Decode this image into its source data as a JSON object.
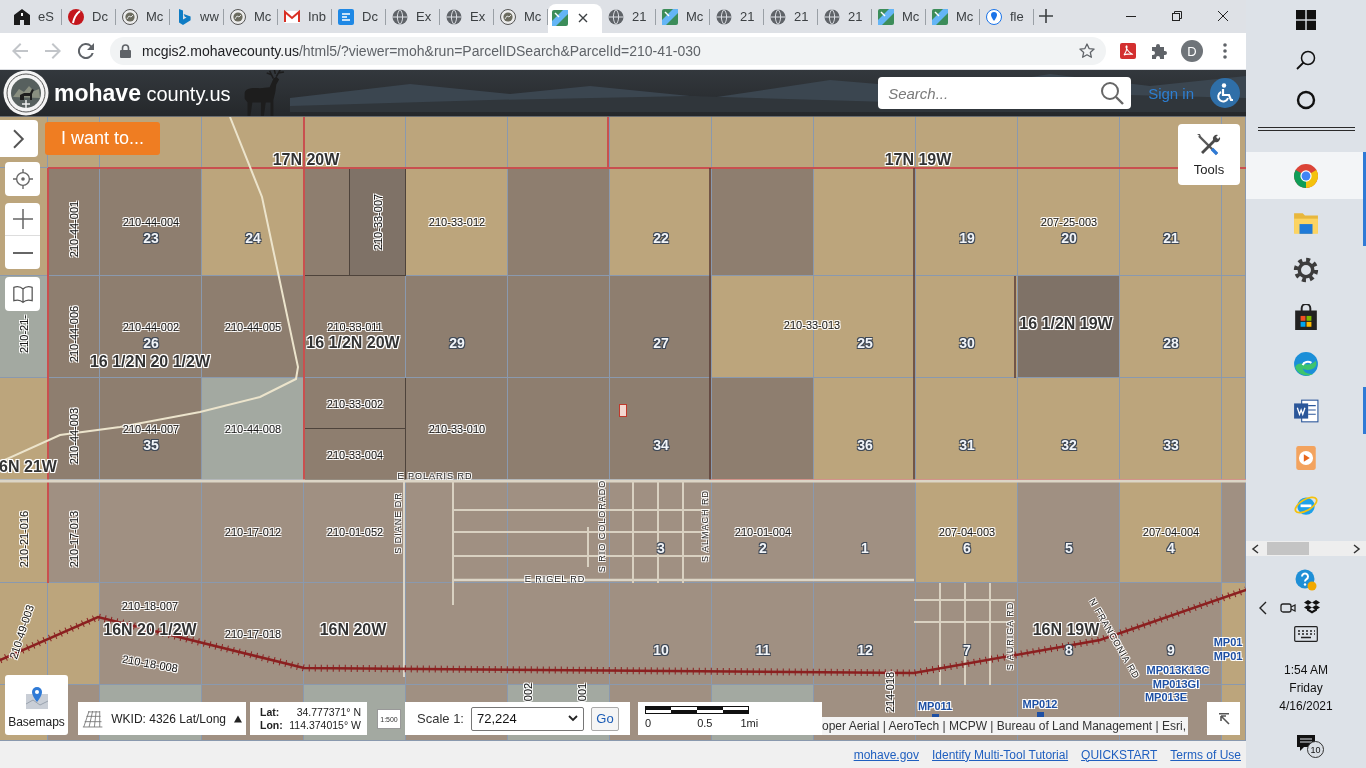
{
  "browser": {
    "tabs": [
      {
        "kind": "building",
        "title": "eS",
        "selected": false
      },
      {
        "kind": "swoosh",
        "title": "Dc",
        "selected": false
      },
      {
        "kind": "seal",
        "title": "Mc",
        "selected": false
      },
      {
        "kind": "ribbon",
        "title": "ww",
        "selected": false
      },
      {
        "kind": "seal",
        "title": "Mc",
        "selected": false
      },
      {
        "kind": "envelope",
        "title": "Inb",
        "selected": false
      },
      {
        "kind": "square",
        "title": "Dc",
        "selected": false
      },
      {
        "kind": "globe",
        "title": "Ex",
        "selected": false
      },
      {
        "kind": "globe",
        "title": "Ex",
        "selected": false
      },
      {
        "kind": "seal",
        "title": "Mc",
        "selected": false
      },
      {
        "kind": "map",
        "selected": true
      },
      {
        "kind": "globe",
        "title": "21",
        "selected": false
      },
      {
        "kind": "map",
        "title": "Mc",
        "selected": false
      },
      {
        "kind": "globe",
        "title": "21",
        "selected": false
      },
      {
        "kind": "globe",
        "title": "21",
        "selected": false
      },
      {
        "kind": "globe",
        "title": "21",
        "selected": false
      },
      {
        "kind": "map",
        "title": "Mc",
        "selected": false
      },
      {
        "kind": "map",
        "title": "Mc",
        "selected": false
      },
      {
        "kind": "pin",
        "title": "fle",
        "selected": false
      }
    ],
    "toolbar": {
      "back": {
        "disabled": true
      },
      "forward": {
        "disabled": true
      },
      "url_host": "mcgis2.mohavecounty.us",
      "url_path": "/html5/?viewer=moh&run=ParcelIDSearch&ParcelId=210-41-030",
      "profile_initial": "D"
    }
  },
  "header": {
    "brand_name": "mohave",
    "brand_suffix": "county.us",
    "search": {
      "placeholder": "Search..."
    },
    "sign_in": "Sign in"
  },
  "map": {
    "i_want_to": "I want to...",
    "tools_label": "Tools",
    "grid": [
      {
        "cells": [
          {
            "kind": "plain",
            "color": "#bca57c"
          },
          {
            "kind": "plain",
            "color": "#bca57c"
          },
          {
            "kind": "plain",
            "color": "#bca57c"
          },
          {
            "kind": "plain",
            "color": "#bca57c"
          },
          {
            "kind": "plain",
            "color": "#bca57c"
          },
          {
            "kind": "plain",
            "color": "#bca57c"
          },
          {
            "kind": "plain",
            "color": "#bca57c"
          },
          {
            "kind": "plain",
            "color": "#bca57c"
          },
          {
            "kind": "plain",
            "color": "#bca57c"
          },
          {
            "kind": "plain",
            "color": "#bca57c"
          },
          {
            "kind": "plain",
            "color": "#bca57c"
          },
          {
            "kind": "plain",
            "color": "#bca57c"
          },
          {
            "kind": "plain",
            "color": "#bca57c"
          },
          {
            "kind": "plain",
            "color": "#bca57c"
          }
        ]
      },
      {
        "cells": [
          {
            "kind": "covered"
          },
          {
            "kind": "vertical",
            "color": "#8e7e6f",
            "parcel": "210-44-001"
          },
          {
            "kind": "plain",
            "color": "#8e7e6f",
            "parcel": "210-44-004",
            "section": "23"
          },
          {
            "kind": "plain",
            "color": "#bca57c",
            "section": "24"
          },
          {
            "kind": "split-v",
            "parts": [
              {
                "color": "#8e7e6f"
              },
              {
                "color": "#7f7267",
                "parcel": "210-33-007"
              }
            ]
          },
          {
            "kind": "plain",
            "color": "#bca57c",
            "parcel": "210-33-012"
          },
          {
            "kind": "plain",
            "color": "#8e7e6f"
          },
          {
            "kind": "plain",
            "color": "#bca57c",
            "section": "22"
          },
          {
            "kind": "plain",
            "color": "#8e7e6f"
          },
          {
            "kind": "plain",
            "color": "#bca57c"
          },
          {
            "kind": "plain",
            "color": "#bca57c",
            "section": "19"
          },
          {
            "kind": "plain",
            "color": "#bca57c",
            "parcel": "207-25-003",
            "section": "20"
          },
          {
            "kind": "plain",
            "color": "#bca57c",
            "section": "21"
          },
          {
            "kind": "plain",
            "color": "#bca57c"
          }
        ]
      },
      {
        "cells": [
          {
            "kind": "vertical",
            "color": "#a3a9a1",
            "parcel": "210-21-"
          },
          {
            "kind": "vertical",
            "color": "#8e7e6f",
            "parcel": "210-44-006"
          },
          {
            "kind": "plain",
            "color": "#8e7e6f",
            "parcel": "210-44-002",
            "section": "26"
          },
          {
            "kind": "plain",
            "color": "#8e7e6f",
            "parcel": "210-44-005"
          },
          {
            "kind": "plain",
            "color": "#8e7e6f",
            "parcel": "210-33-011"
          },
          {
            "kind": "plain",
            "color": "#8e7e6f",
            "section": "29"
          },
          {
            "kind": "plain",
            "color": "#8e7e6f"
          },
          {
            "kind": "plain",
            "color": "#8e7e6f",
            "section": "27"
          },
          {
            "kind": "plain",
            "color": "#bca57c"
          },
          {
            "kind": "plain",
            "color": "#bca57c",
            "section": "25"
          },
          {
            "kind": "plain",
            "color": "#bca57c",
            "section": "30"
          },
          {
            "kind": "plain",
            "color": "#7f7267"
          },
          {
            "kind": "plain",
            "color": "#bca57c",
            "section": "28"
          },
          {
            "kind": "plain",
            "color": "#bca57c"
          }
        ]
      },
      {
        "cells": [
          {
            "kind": "plain",
            "color": "#bca57c"
          },
          {
            "kind": "vertical",
            "color": "#8e7e6f",
            "parcel": "210-44-003"
          },
          {
            "kind": "plain",
            "color": "#8e7e6f",
            "parcel": "210-44-007",
            "section": "35"
          },
          {
            "kind": "plain",
            "color": "#a3a9a1",
            "parcel": "210-44-008"
          },
          {
            "kind": "split-h",
            "parts": [
              {
                "color": "#8e7e6f",
                "parcel": "210-33-002"
              },
              {
                "color": "#8e7e6f",
                "parcel": "210-33-004"
              }
            ]
          },
          {
            "kind": "plain",
            "color": "#8e7e6f",
            "parcel": "210-33-010"
          },
          {
            "kind": "plain",
            "color": "#8e7e6f"
          },
          {
            "kind": "plain",
            "color": "#8e7e6f",
            "section": "34"
          },
          {
            "kind": "plain",
            "color": "#8e7e6f"
          },
          {
            "kind": "plain",
            "color": "#bca57c",
            "section": "36"
          },
          {
            "kind": "plain",
            "color": "#bca57c",
            "section": "31"
          },
          {
            "kind": "plain",
            "color": "#bca57c",
            "section": "32"
          },
          {
            "kind": "plain",
            "color": "#bca57c",
            "section": "33"
          },
          {
            "kind": "plain",
            "color": "#bca57c"
          }
        ]
      },
      {
        "cells": [
          {
            "kind": "vertical",
            "color": "#bca57c",
            "parcel": "210-21-016"
          },
          {
            "kind": "vertical",
            "color": "#a09082",
            "parcel": "210-17-013"
          },
          {
            "kind": "plain",
            "color": "#a09082"
          },
          {
            "kind": "plain",
            "color": "#a09082",
            "parcel": "210-17-012"
          },
          {
            "kind": "plain",
            "color": "#a09082",
            "parcel": "210-01-052"
          },
          {
            "kind": "plain",
            "color": "#a09082"
          },
          {
            "kind": "plain",
            "color": "#a09082"
          },
          {
            "kind": "plain",
            "color": "#a09082",
            "section": "3"
          },
          {
            "kind": "plain",
            "color": "#a09082",
            "parcel": "210-01-004",
            "section": "2"
          },
          {
            "kind": "plain",
            "color": "#a09082",
            "section": "1"
          },
          {
            "kind": "plain",
            "color": "#bca57c",
            "parcel": "207-04-003",
            "section": "6"
          },
          {
            "kind": "plain",
            "color": "#a09082",
            "section": "5"
          },
          {
            "kind": "plain",
            "color": "#bca57c",
            "parcel": "207-04-004",
            "section": "4"
          },
          {
            "kind": "plain",
            "color": "#a09082"
          }
        ]
      },
      {
        "cells": [
          {
            "kind": "plain",
            "color": "#bca57c"
          },
          {
            "kind": "plain",
            "color": "#bca57c"
          },
          {
            "kind": "plain",
            "color": "#a09082"
          },
          {
            "kind": "plain",
            "color": "#a09082",
            "parcel": "210-17-018"
          },
          {
            "kind": "plain",
            "color": "#a09082"
          },
          {
            "kind": "plain",
            "color": "#a09082"
          },
          {
            "kind": "plain",
            "color": "#a09082"
          },
          {
            "kind": "plain",
            "color": "#a09082",
            "section": "10"
          },
          {
            "kind": "plain",
            "color": "#a09082",
            "section": "11"
          },
          {
            "kind": "plain",
            "color": "#a09082",
            "section": "12"
          },
          {
            "kind": "plain",
            "color": "#a09082",
            "section": "7"
          },
          {
            "kind": "plain",
            "color": "#a09082",
            "section": "8"
          },
          {
            "kind": "plain",
            "color": "#a09082",
            "section": "9"
          },
          {
            "kind": "plain",
            "color": "#bca57c"
          }
        ]
      },
      {
        "cells": [
          {
            "kind": "plain",
            "color": "#bca57c"
          },
          {
            "kind": "plain",
            "color": "#a09082"
          },
          {
            "kind": "plain",
            "color": "#a3a9a1"
          },
          {
            "kind": "plain",
            "color": "#a09082"
          },
          {
            "kind": "plain",
            "color": "#a3a9a1"
          },
          {
            "kind": "plain",
            "color": "#a09082"
          },
          {
            "kind": "plain",
            "color": "#a3a9a1"
          },
          {
            "kind": "plain",
            "color": "#a09082"
          },
          {
            "kind": "plain",
            "color": "#a3a9a1"
          },
          {
            "kind": "plain",
            "color": "#a09082"
          },
          {
            "kind": "plain",
            "color": "#a09082"
          },
          {
            "kind": "plain",
            "color": "#a09082"
          },
          {
            "kind": "plain",
            "color": "#a09082"
          },
          {
            "kind": "plain",
            "color": "#bca57c"
          }
        ]
      }
    ],
    "labels": [
      {
        "kind": "township",
        "text": "17N 20W"
      },
      {
        "kind": "township",
        "text": "17N 19W"
      },
      {
        "kind": "township",
        "text": "16 1/2N 19W"
      },
      {
        "kind": "parcel",
        "text": "210-33-013"
      },
      {
        "kind": "township",
        "text": "16 1/2N 20W"
      },
      {
        "kind": "township",
        "text": "16 1/2N 20 1/2W"
      },
      {
        "kind": "township",
        "text": "6N 21W"
      },
      {
        "kind": "road",
        "text": "E POLARIS RD"
      },
      {
        "kind": "road",
        "text": "S DIANE DR"
      },
      {
        "kind": "road",
        "text": "S RIO COLORADO"
      },
      {
        "kind": "road",
        "text": "S ALMACH RD"
      },
      {
        "kind": "road",
        "text": "E RIGEL RD"
      },
      {
        "kind": "parcel",
        "text": "210-18-007"
      },
      {
        "kind": "road",
        "text": "S AURIGA RD"
      },
      {
        "kind": "township",
        "text": "16N 20 1/2W"
      },
      {
        "kind": "township",
        "text": "16N 20W"
      },
      {
        "kind": "township",
        "text": "16N 19W"
      },
      {
        "kind": "parcel",
        "text": "210-49-003"
      },
      {
        "kind": "road",
        "text": "N FRANCONIA RD"
      },
      {
        "kind": "milepost",
        "text": "MP01"
      },
      {
        "kind": "milepost",
        "text": "MP01"
      },
      {
        "kind": "parcel",
        "text": "210-18-008"
      },
      {
        "kind": "milepost",
        "text": "MP013K13C"
      },
      {
        "kind": "milepost",
        "text": "MP013GI"
      },
      {
        "kind": "milepost",
        "text": "MP013E"
      },
      {
        "kind": "parcel",
        "text": "002"
      },
      {
        "kind": "parcel",
        "text": "001"
      },
      {
        "kind": "parcel",
        "text": "214-018"
      },
      {
        "kind": "milepost",
        "text": "MP012"
      },
      {
        "kind": "milepost",
        "text": "MP011"
      }
    ]
  },
  "map_footer": {
    "basemaps_label": "Basemaps",
    "projection": "WKID: 4326 Lat/Long",
    "lat_label": "Lat:",
    "lat": "34.777371° N",
    "lon_label": "Lon:",
    "lon": "114.374015° W",
    "scale_icon_text": "1:500",
    "scale_label": "Scale 1:",
    "scale_value": "72,224",
    "go": "Go",
    "scale_bar_ticks": [
      "0",
      "0.5",
      "1mi"
    ],
    "attribution": "oper Aerial | AeroTech | MCPW | Bureau of Land Management | Esri,"
  },
  "footer_links": [
    "mohave.gov",
    "Identify Multi-Tool Tutorial",
    "QUICKSTART",
    "Terms of Use"
  ],
  "taskbar": {
    "apps": [
      {
        "kind": "ring",
        "running": true,
        "selected": true
      },
      {
        "kind": "folder",
        "running": true,
        "selected": false
      },
      {
        "kind": "gear",
        "running": false,
        "selected": false
      },
      {
        "kind": "bag",
        "running": false,
        "selected": false
      },
      {
        "kind": "wave",
        "running": false,
        "selected": false
      },
      {
        "kind": "document",
        "running": true,
        "selected": false
      },
      {
        "kind": "play",
        "running": false,
        "selected": false
      },
      {
        "kind": "orbit",
        "running": false,
        "selected": false
      }
    ],
    "clock": {
      "time": "1:54 AM",
      "day": "Friday",
      "date": "4/16/2021"
    },
    "notification_count": "10"
  }
}
